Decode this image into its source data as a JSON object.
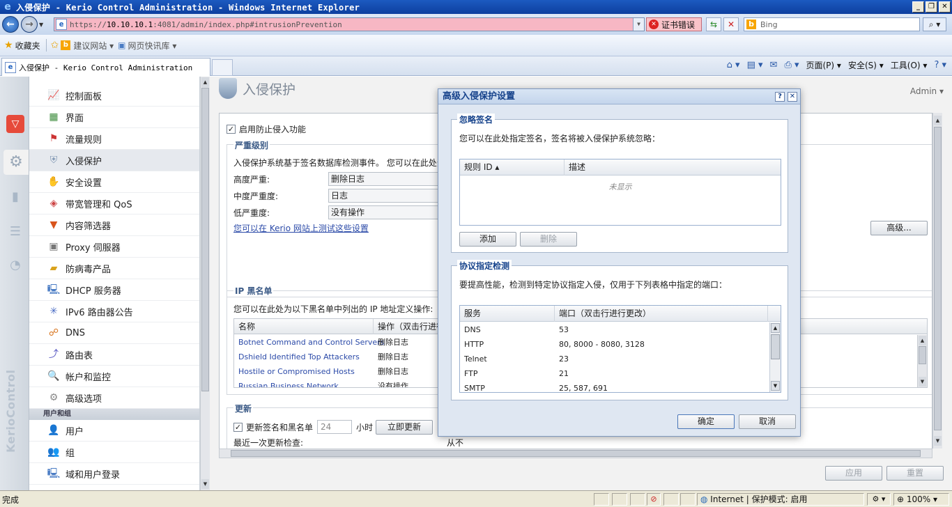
{
  "window": {
    "title": "入侵保护 - Kerio Control Administration - Windows Internet Explorer"
  },
  "address": {
    "url_scheme": "https://",
    "url_host": "10.10.10.1",
    "url_rest": ":4081/admin/index.php#intrusionPrevention",
    "cert_error": "证书错误"
  },
  "search": {
    "placeholder": "Bing"
  },
  "favorites": {
    "label": "收藏夹",
    "suggested": "建议网站 ▾",
    "webslice": "网页快讯库 ▾"
  },
  "tab": {
    "title": "入侵保护 - Kerio Control Administration"
  },
  "commandbar": {
    "page": "页面(P) ▾",
    "safety": "安全(S) ▾",
    "tools": "工具(O) ▾"
  },
  "sidebar": {
    "items": [
      {
        "label": "控制面板",
        "icon": "dashboard-icon"
      },
      {
        "label": "界面",
        "icon": "interface-icon"
      },
      {
        "label": "流量规则",
        "icon": "traffic-rules-icon"
      },
      {
        "label": "入侵保护",
        "icon": "shield-icon"
      },
      {
        "label": "安全设置",
        "icon": "security-icon"
      },
      {
        "label": "带宽管理和 QoS",
        "icon": "bandwidth-icon"
      },
      {
        "label": "内容筛选器",
        "icon": "filter-icon"
      },
      {
        "label": "Proxy 伺服器",
        "icon": "proxy-icon"
      },
      {
        "label": "防病毒产品",
        "icon": "antivirus-icon"
      },
      {
        "label": "DHCP 服务器",
        "icon": "dhcp-icon"
      },
      {
        "label": "IPv6 路由器公告",
        "icon": "ipv6-icon"
      },
      {
        "label": "DNS",
        "icon": "dns-icon"
      },
      {
        "label": "路由表",
        "icon": "routing-icon"
      },
      {
        "label": "帐户和监控",
        "icon": "accounting-icon"
      },
      {
        "label": "高级选项",
        "icon": "advanced-icon"
      }
    ],
    "group_label": "用户和组",
    "group_items": [
      {
        "label": "用户",
        "icon": "user-icon"
      },
      {
        "label": "组",
        "icon": "group-icon"
      },
      {
        "label": "域和用户登录",
        "icon": "domain-icon"
      }
    ],
    "brand": "KerioControl"
  },
  "page": {
    "title": "入侵保护",
    "admin": "Admin ▾",
    "enable_label": "启用防止侵入功能",
    "severity": {
      "legend": "严重级别",
      "desc": "入侵保护系统基于签名数据库检测事件。 您可以在此处分",
      "rows": [
        {
          "label": "高度严重:",
          "value": "删除日志"
        },
        {
          "label": "中度严重度:",
          "value": "日志"
        },
        {
          "label": "低严重度:",
          "value": "没有操作"
        }
      ],
      "test_link": "您可以在 Kerio 网站上测试这些设置",
      "advanced_btn": "高级..."
    },
    "blacklist": {
      "legend": "IP 黑名单",
      "desc": "您可以在此处为以下黑名单中列出的 IP 地址定义操作:",
      "col_name": "名称",
      "col_action": "操作（双击行进行",
      "rows": [
        {
          "name": "Botnet Command and Control Servers",
          "action": "删除日志"
        },
        {
          "name": "Dshield Identified Top Attackers",
          "action": "删除日志"
        },
        {
          "name": "Hostile or Compromised Hosts",
          "action": "删除日志"
        },
        {
          "name": "Russian Business Network",
          "action": "没有操作"
        }
      ]
    },
    "update": {
      "legend": "更新",
      "check_label": "更新签名和黑名单",
      "hours_value": "24",
      "hours_unit": "小时",
      "update_now": "立即更新",
      "last_check_label": "最近一次更新检查:",
      "last_check_value": "从不"
    },
    "apply": "应用",
    "reset": "重置"
  },
  "dialog": {
    "title": "高级入侵保护设置",
    "ignore": {
      "legend": "忽略签名",
      "desc": "您可以在此处指定签名，签名将被入侵保护系统忽略：",
      "col_id": "规则 ID ▴",
      "col_desc": "描述",
      "empty": "未显示",
      "add": "添加",
      "remove": "删除"
    },
    "protocol": {
      "legend": "协议指定检测",
      "desc": "要提高性能，检测到特定协议指定入侵，仅用于下列表格中指定的端口：",
      "col_service": "服务",
      "col_port": "端口（双击行进行更改）",
      "rows": [
        {
          "service": "DNS",
          "ports": "53"
        },
        {
          "service": "HTTP",
          "ports": "80, 8000 - 8080, 3128"
        },
        {
          "service": "Telnet",
          "ports": "23"
        },
        {
          "service": "FTP",
          "ports": "21"
        },
        {
          "service": "SMTP",
          "ports": "25, 587, 691"
        }
      ]
    },
    "ok": "确定",
    "cancel": "取消"
  },
  "status": {
    "text": "完成",
    "zone": "Internet | 保护模式: 启用",
    "zoom": "100%"
  }
}
